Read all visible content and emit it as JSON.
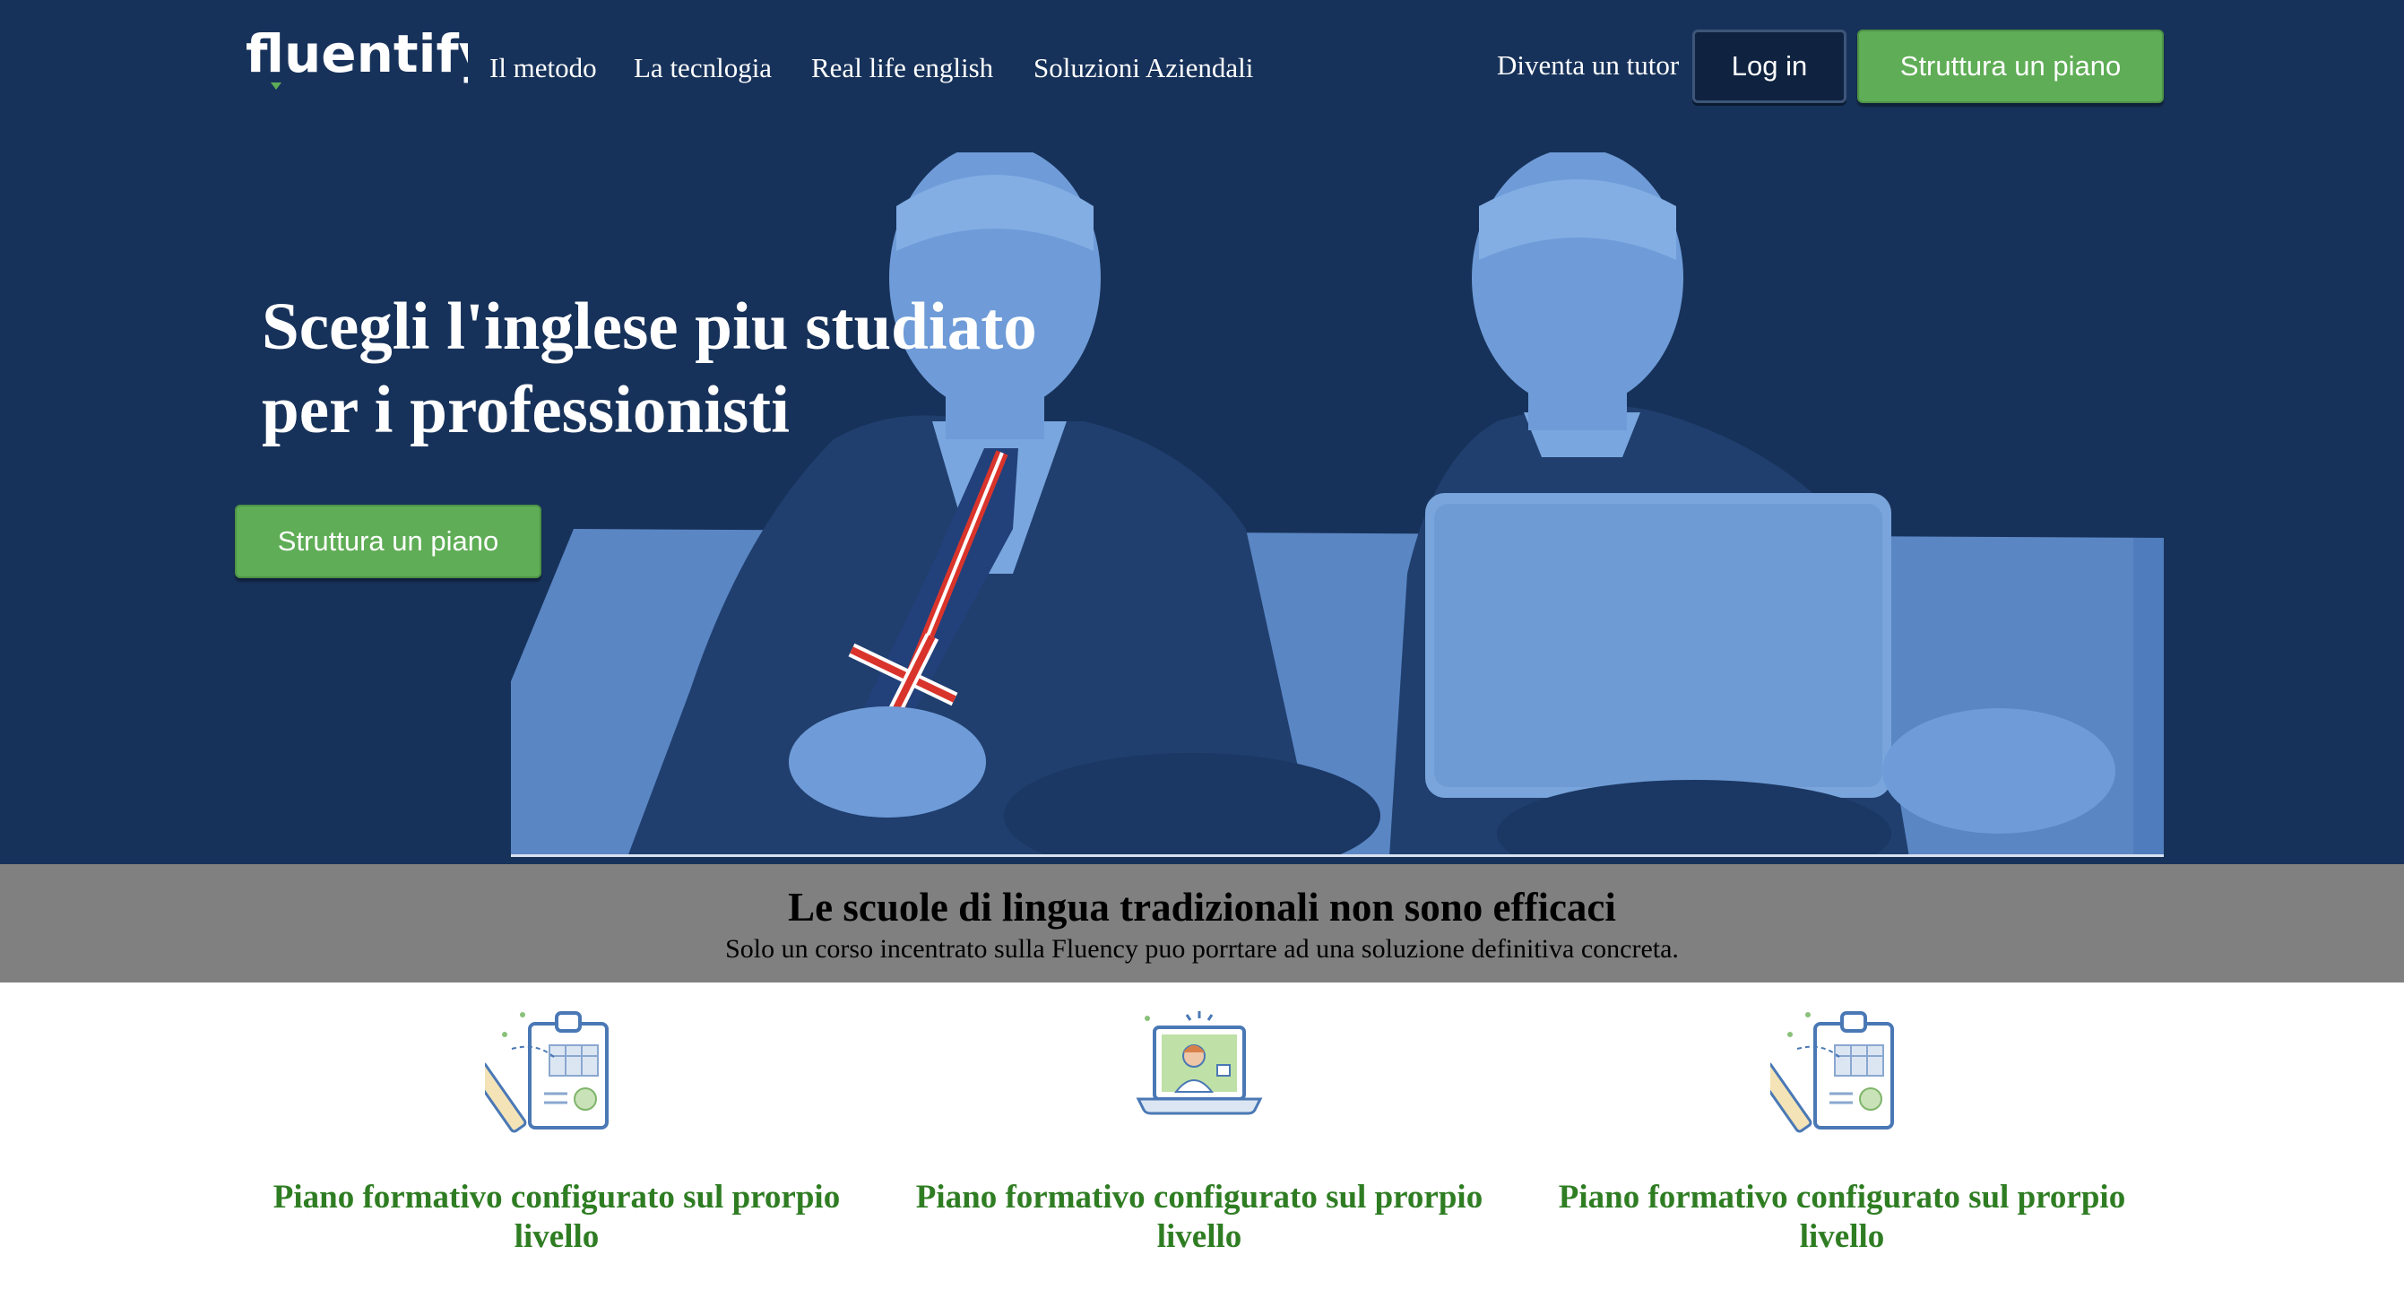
{
  "brand": {
    "name": "fluentify"
  },
  "nav": {
    "links": [
      "Il metodo",
      "La tecnlogia",
      "Real life english",
      "Soluzioni Aziendali"
    ],
    "tutor_link": "Diventa un tutor",
    "login_label": "Log in",
    "plan_label": "Struttura un piano"
  },
  "hero": {
    "title_line1": "Scegli l'inglese piu studiato",
    "title_line2": "per i professionisti",
    "cta_label": "Struttura un piano"
  },
  "band": {
    "title": "Le scuole di lingua tradizionali non sono efficaci",
    "subtitle": "Solo un corso incentrato sulla Fluency puo porrtare ad una soluzione definitiva concreta."
  },
  "features": [
    {
      "icon": "clipboard-chart-icon",
      "text": "Piano formativo configurato sul prorpio livello"
    },
    {
      "icon": "laptop-tutor-icon",
      "text": "Piano formativo configurato sul prorpio livello"
    },
    {
      "icon": "clipboard-chart-icon",
      "text": "Piano formativo configurato sul prorpio livello"
    }
  ],
  "colors": {
    "hero_bg": "#17325a",
    "accent_green": "#5fad56",
    "feature_text": "#2f7d23",
    "band_bg": "#808080",
    "photo_tint": "#6b9ad6"
  }
}
